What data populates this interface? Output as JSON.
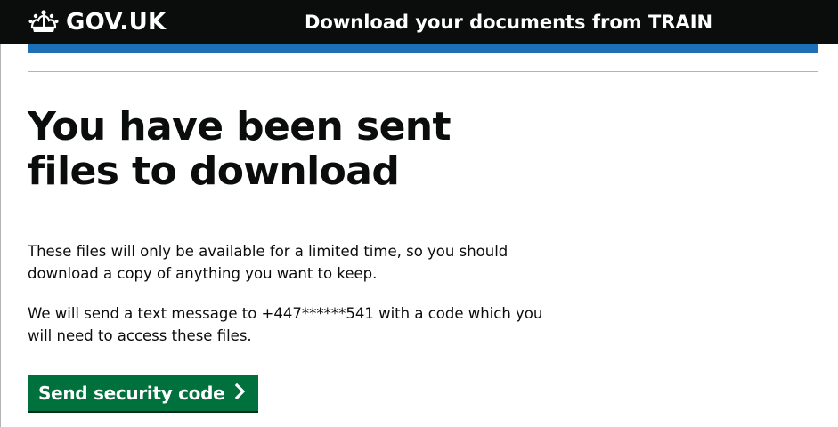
{
  "header": {
    "logo_text": "GOV.UK",
    "logo_icon": "crown-icon",
    "service_name": "Download your documents from TRAIN"
  },
  "main": {
    "heading": "You have been sent files to download",
    "paragraph_1": "These files will only be available for a limited time, so you should download a copy of anything you want to keep.",
    "paragraph_2": "We will send a text message to +447******541 with a code which you will need to access these files.",
    "button_label": "Send security code",
    "button_icon": "chevron-right-icon"
  },
  "colors": {
    "header_background": "#0b0c0c",
    "header_accent": "#1d70b8",
    "button_background": "#00703c",
    "text": "#0b0c0c"
  }
}
